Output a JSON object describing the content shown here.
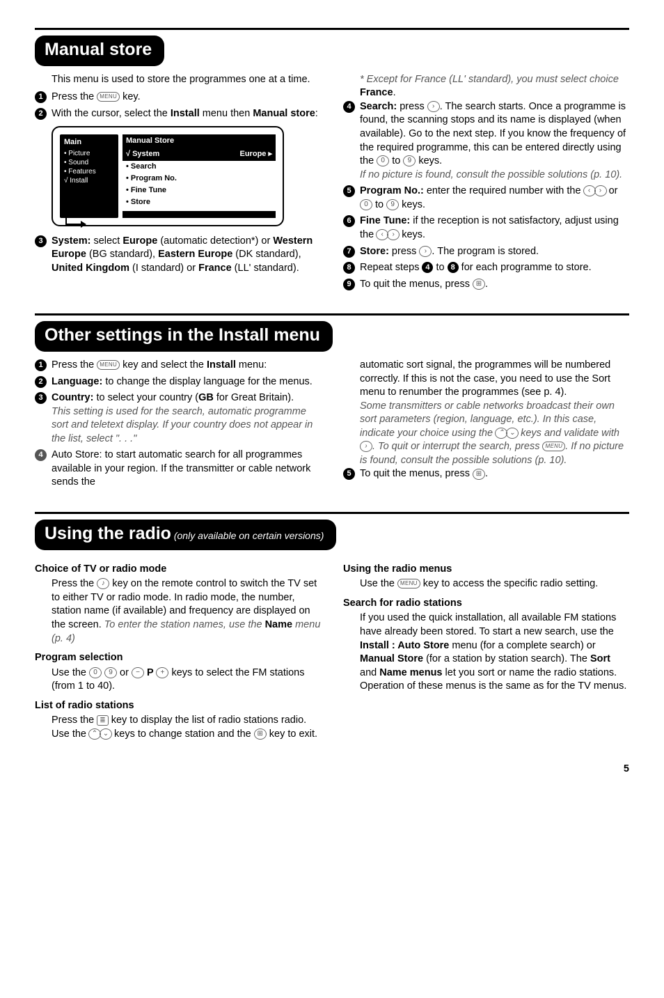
{
  "icons": {
    "menu": "MENU",
    "exit": "⊞",
    "zero": "0",
    "nine": "9",
    "left": "‹",
    "right": "›",
    "up": "⌃",
    "down": "⌄",
    "minus": "−",
    "plus": "+",
    "list": "≣"
  },
  "manual": {
    "title": "Manual store",
    "intro": "This menu is used to store the programmes one at a time.",
    "step1a": "Press the ",
    "step1b": " key.",
    "step2a": "With the cursor, select the ",
    "step2b": "Install",
    "step2c": " menu then ",
    "step2d": "Manual store",
    "step2e": ":",
    "menu": {
      "main_hdr": "Main",
      "main_items": [
        "• Picture",
        "• Sound",
        "• Features",
        "√ Install"
      ],
      "sub_hdr": "Manual Store",
      "sub_sel": "√ System",
      "sub_sel_val": "Europe ▸",
      "sub_items": [
        "• Search",
        "• Program No.",
        "• Fine Tune",
        "• Store"
      ]
    },
    "step3a": "System:",
    "step3b": " select ",
    "step3c": "Europe",
    "step3d": " (automatic detection*) or ",
    "step3e": "Western Europe",
    "step3f": " (BG standard), ",
    "step3g": "Eastern Europe",
    "step3h": " (DK standard), ",
    "step3i": "United Kingdom",
    "step3j": " (I standard) or ",
    "step3k": "France",
    "step3l": " (LL' standard).",
    "note_a": "* Except for France (LL' standard), you must select choice ",
    "note_b": "France",
    "note_c": ".",
    "step4a": "Search:",
    "step4b": " press ",
    "step4c": ". The search starts. Once a programme is found, the scanning stops and its name is displayed (when available). Go to the next step. If you know the frequency of the required programme, this can be entered directly using the ",
    "step4d": " to ",
    "step4e": " keys.",
    "step4f": "If no picture is found, consult the possible solutions (p. 10).",
    "step5a": "Program No.:",
    "step5b": " enter the required number with the ",
    "step5c": " or ",
    "step5d": " to ",
    "step5e": " keys.",
    "step6a": "Fine Tune:",
    "step6b": " if the reception is not satisfactory, adjust using the ",
    "step6c": " keys.",
    "step7a": "Store:",
    "step7b": " press ",
    "step7c": ". The program is stored.",
    "step8a": "Repeat steps ",
    "step8b": " to ",
    "step8c": " for each programme to store.",
    "step9a": "To quit the menus, press ",
    "step9b": "."
  },
  "other": {
    "title": "Other settings in the Install menu",
    "step1a": "Press the ",
    "step1b": " key and select the ",
    "step1c": "Install",
    "step1d": " menu:",
    "step2a": "Language:",
    "step2b": " to change the display language for the menus.",
    "step3a": "Country:",
    "step3b": " to select your country (",
    "step3c": "GB",
    "step3d": " for Great Britain).",
    "step3e": "This setting is used for the search, automatic programme sort and teletext display. If your country does not appear in the list, select \". . .\"",
    "step4a": "Auto Store: to start automatic search for all programmes available in your region. If the transmitter or cable network sends the ",
    "rcol_a": "automatic sort signal, the programmes will be numbered correctly. If this is not the case, you need to use the Sort menu to renumber the programmes (see p. 4).",
    "rcol_b": "Some transmitters or cable networks broadcast their own sort parameters (region, language, etc.). In this case, indicate your choice using the ",
    "rcol_c": " keys and validate with ",
    "rcol_d": ". To quit or interrupt the search, press ",
    "rcol_e": ". If no picture is found, consult the possible solutions (p. 10).",
    "step5a": "To quit the menus, press ",
    "step5b": "."
  },
  "radio": {
    "title": "Using the radio",
    "subtitle": " (only available on certain versions)",
    "h1": "Choice of TV or radio mode",
    "h1a": "Press the ",
    "h1b": " key on the remote control to switch the TV set to either TV or radio mode. In radio mode, the number, station name (if available) and frequency are displayed on the screen. ",
    "h1c": "To enter the station names, use the ",
    "h1d": "Name",
    "h1e": " menu (p. 4)",
    "h2": "Program selection",
    "h2a": "Use the ",
    "h2b": " or ",
    "h2c": " P ",
    "h2d": " keys to select the FM stations (from 1 to 40).",
    "h3": "List of radio stations",
    "h3a": "Press the ",
    "h3b": " key to display the list of radio stations radio. Use the ",
    "h3c": " keys to change station and the ",
    "h3d": " key to exit.",
    "h4": "Using the radio menus",
    "h4a": "Use the ",
    "h4b": " key to access the specific radio setting.",
    "h5": "Search for radio stations",
    "h5a": "If you used the quick installation, all available FM stations have already been stored. To start a new search, use the ",
    "h5b": "Install : Auto Store",
    "h5c": " menu (for a complete search) or ",
    "h5d": "Manual Store",
    "h5e": " (for a station by station search). The ",
    "h5f": "Sort",
    "h5g": " and ",
    "h5h": "Name menus",
    "h5i": " let you sort or name the radio stations. Operation of these menus is the same as for the TV menus."
  },
  "page": "5"
}
